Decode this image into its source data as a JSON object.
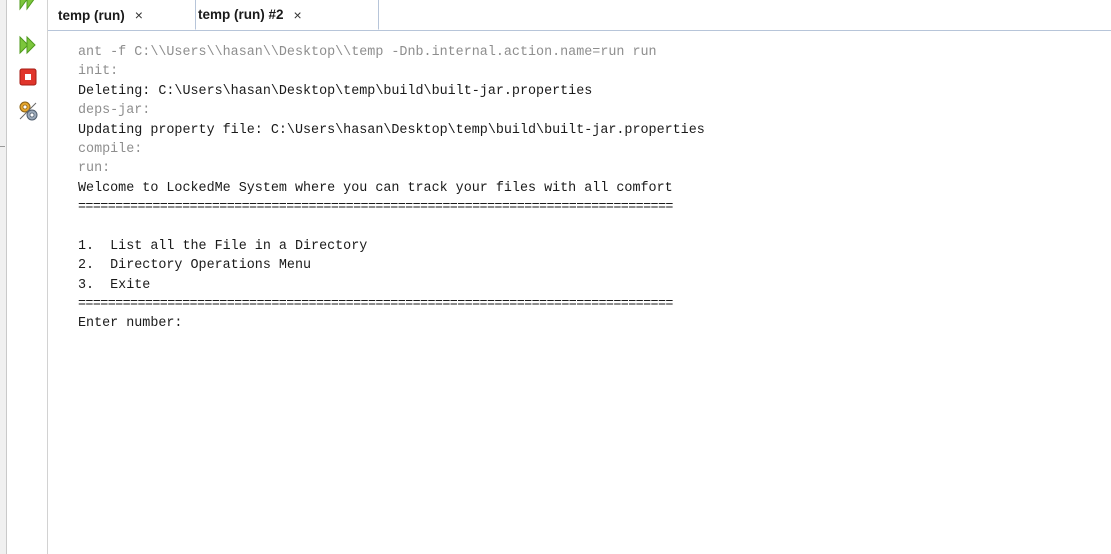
{
  "tabs": [
    {
      "label": "temp (run)",
      "close": "×"
    },
    {
      "label": "temp (run) #2",
      "close": "×"
    }
  ],
  "toolbar": {
    "icons": [
      "rerun-icon",
      "rerun-with-options-icon",
      "stop-icon",
      "settings-icon"
    ],
    "colors": {
      "rerun": "#6bbf2a",
      "stop": "#d9251d"
    }
  },
  "console": {
    "lines": [
      {
        "text": "ant -f C:\\\\Users\\\\hasan\\\\Desktop\\\\temp -Dnb.internal.action.name=run run",
        "style": "gray"
      },
      {
        "text": "init:",
        "style": "gray"
      },
      {
        "text": "Deleting: C:\\Users\\hasan\\Desktop\\temp\\build\\built-jar.properties",
        "style": "normal"
      },
      {
        "text": "deps-jar:",
        "style": "gray"
      },
      {
        "text": "Updating property file: C:\\Users\\hasan\\Desktop\\temp\\build\\built-jar.properties",
        "style": "normal"
      },
      {
        "text": "compile:",
        "style": "gray"
      },
      {
        "text": "run:",
        "style": "gray"
      },
      {
        "text": "Welcome to LockedMe System where you can track your files with all comfort",
        "style": "normal"
      },
      {
        "text": "================================================================================",
        "style": "sep"
      },
      {
        "text": "",
        "style": "normal"
      },
      {
        "text": "1.  List all the File in a Directory",
        "style": "normal"
      },
      {
        "text": "2.  Directory Operations Menu",
        "style": "normal"
      },
      {
        "text": "3.  Exite",
        "style": "normal"
      },
      {
        "text": "================================================================================",
        "style": "sep"
      },
      {
        "text": "Enter number:",
        "style": "normal"
      }
    ]
  }
}
